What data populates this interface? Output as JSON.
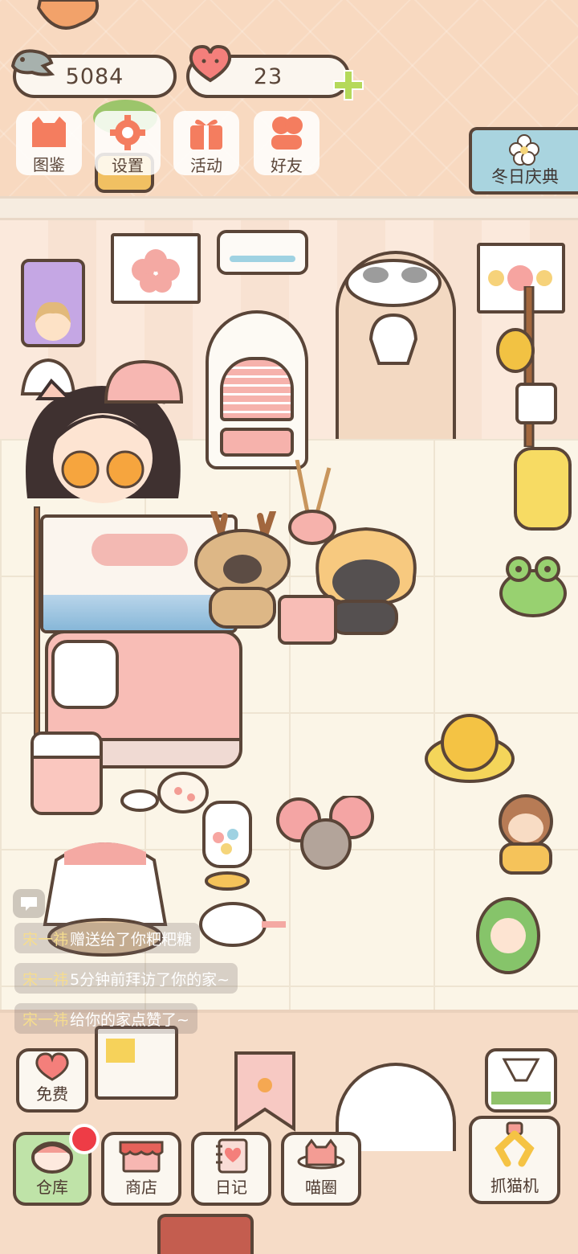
{
  "hud": {
    "fish_count": "5084",
    "heart_count": "23"
  },
  "menu": [
    {
      "label": "图鉴",
      "icon": "cat-book-icon"
    },
    {
      "label": "设置",
      "icon": "gear-icon"
    },
    {
      "label": "活动",
      "icon": "gift-icon"
    },
    {
      "label": "好友",
      "icon": "friends-icon"
    }
  ],
  "event_banner": {
    "label": "冬日庆典",
    "icon": "flower-icon"
  },
  "chat": {
    "messages": [
      {
        "user": "宋一祎",
        "text": "赠送给了你粑粑糖"
      },
      {
        "user": "宋一祎",
        "text": "5分钟前拜访了你的家~"
      },
      {
        "user": "宋一祎",
        "text": "给你的家点赞了~"
      }
    ]
  },
  "bottom_bar": {
    "free": "免费",
    "warehouse": "仓库",
    "shop": "商店",
    "diary": "日记",
    "cat_circle": "喵圈",
    "claw_machine": "抓猫机"
  },
  "colors": {
    "outline": "#5a4538",
    "wall": "#f8d9c0",
    "floor": "#fbf5e7",
    "accent_green": "#bfe3a8",
    "badge_red": "#ee3c46"
  }
}
